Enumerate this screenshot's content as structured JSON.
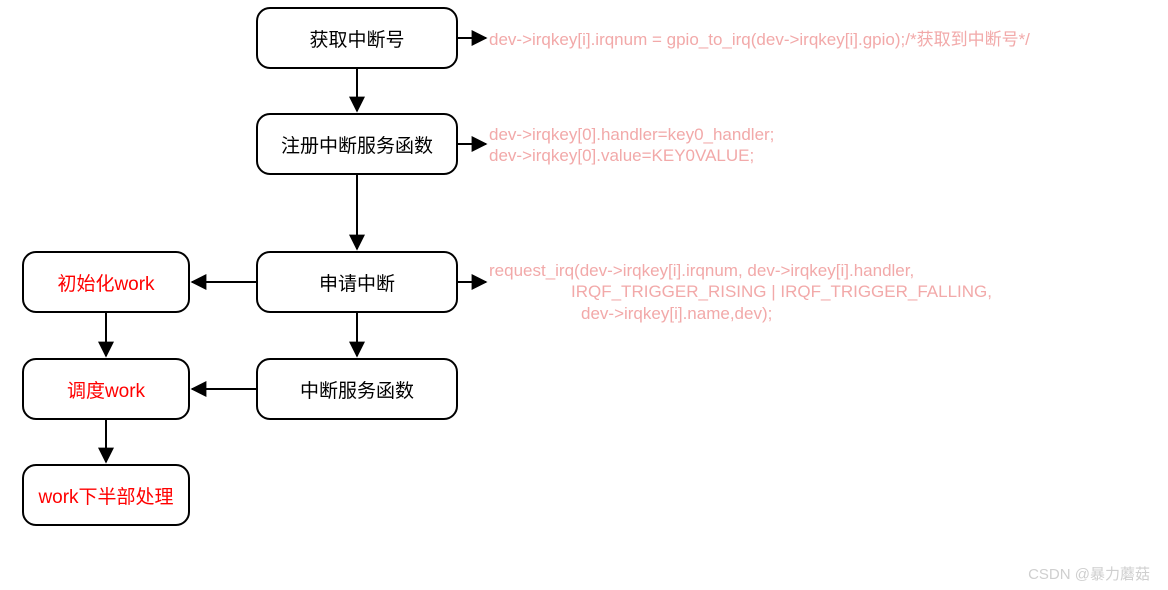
{
  "nodes": {
    "n1": "获取中断号",
    "n2": "注册中断服务函数",
    "n3": "申请中断",
    "n4": "中断服务函数",
    "l1": "初始化work",
    "l2": "调度work",
    "l3": "work下半部处理"
  },
  "annotations": {
    "a1": "dev->irqkey[i].irqnum = gpio_to_irq(dev->irqkey[i].gpio);/*获取到中断号*/",
    "a2_l1": "dev->irqkey[0].handler=key0_handler;",
    "a2_l2": "dev->irqkey[0].value=KEY0VALUE;",
    "a3_l1": "request_irq(dev->irqkey[i].irqnum, dev->irqkey[i].handler,",
    "a3_l2": "IRQF_TRIGGER_RISING | IRQF_TRIGGER_FALLING,",
    "a3_l3": "dev->irqkey[i].name,dev);"
  },
  "watermark": "CSDN @暴力蘑菇"
}
